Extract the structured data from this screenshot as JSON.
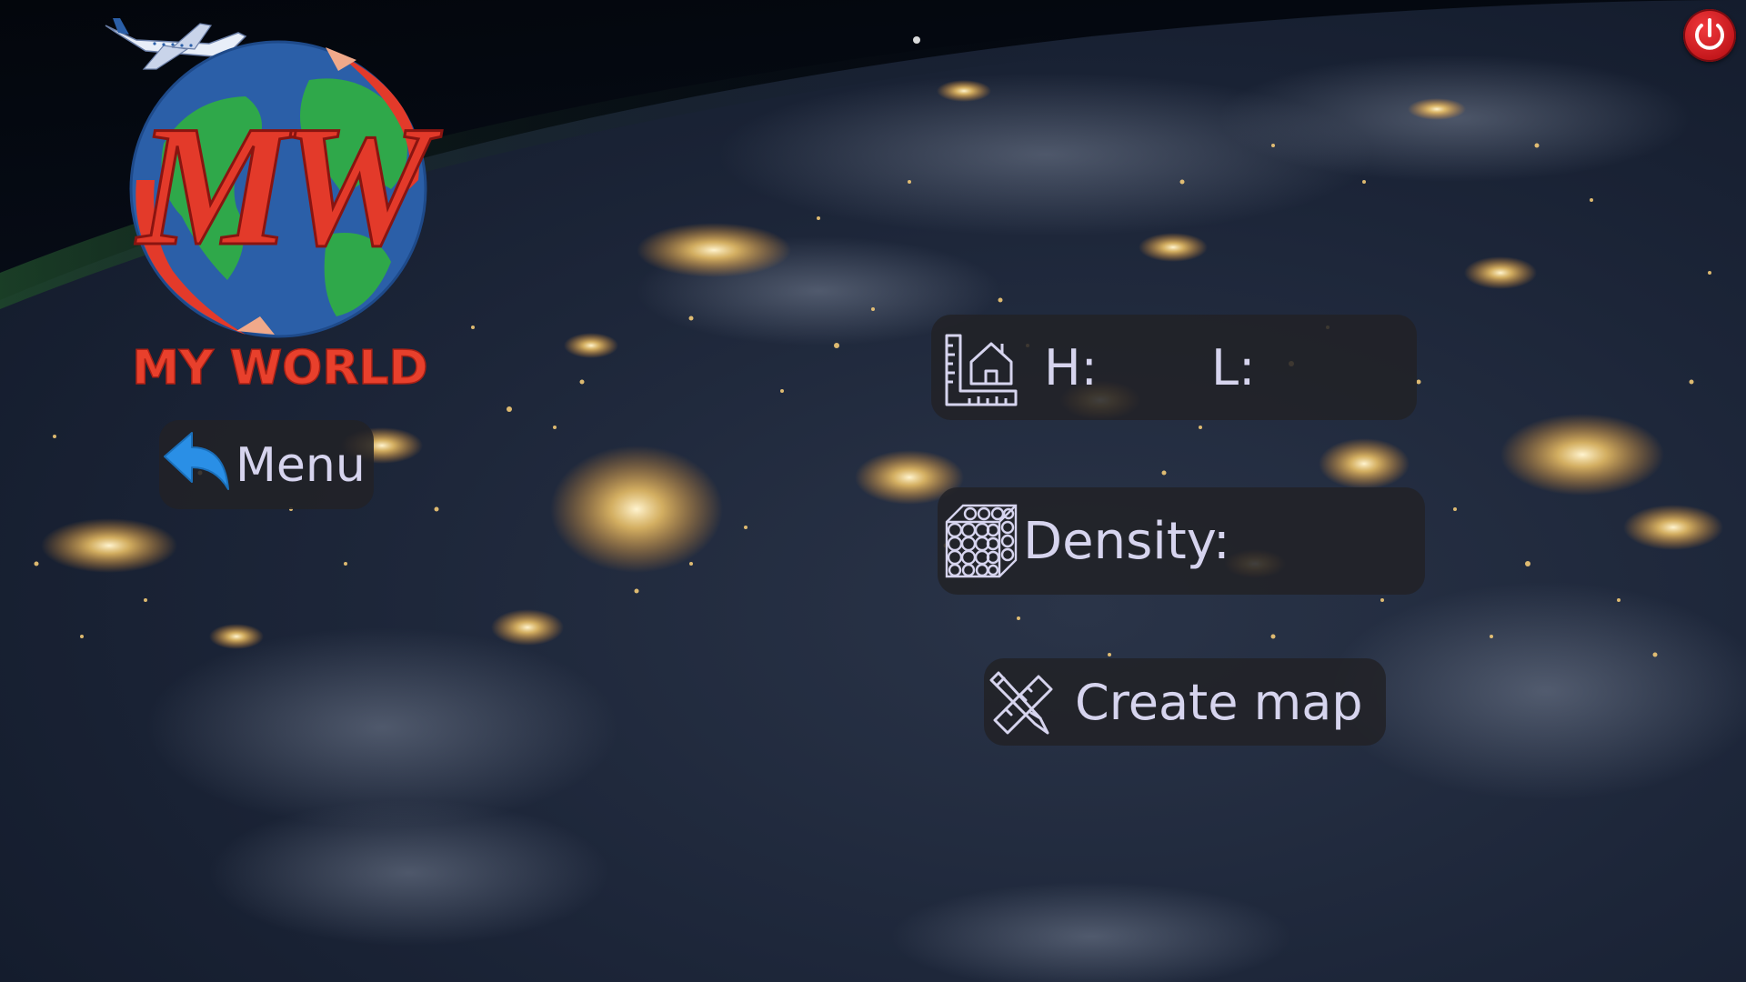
{
  "app": {
    "logo_text": "MY WORLD",
    "logo_monogram": "MW"
  },
  "power": {
    "icon": "power-icon"
  },
  "menu": {
    "label": "Menu",
    "icon": "back-arrow-icon"
  },
  "size": {
    "icon": "ruler-house-icon",
    "height_label": "H:",
    "height_value": "",
    "length_label": "L:",
    "length_value": ""
  },
  "density": {
    "icon": "density-grid-icon",
    "label": "Density:",
    "value": ""
  },
  "create_map": {
    "icon": "pencil-ruler-icon",
    "label": "Create map"
  },
  "colors": {
    "panel": "#222226",
    "text": "#d6d4ee",
    "power_red": "#e0262b",
    "menu_arrow_blue": "#2a8fe6",
    "logo_red": "#e33a2a",
    "logo_blue": "#2b5fa8",
    "logo_green": "#2fa84a"
  }
}
